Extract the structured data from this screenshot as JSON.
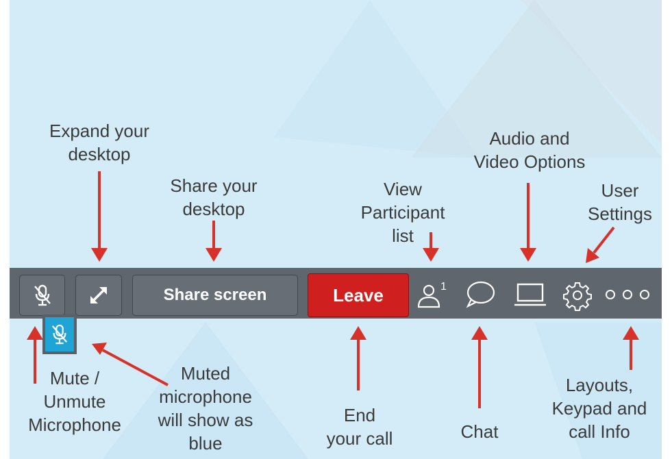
{
  "annotations": {
    "expand": "Expand your\ndesktop",
    "share": "Share your\ndesktop",
    "participants": "View\nParticipant\nlist",
    "av_options": "Audio and\nVideo Options",
    "user_settings": "User\nSettings",
    "mute": "Mute /\nUnmute\nMicrophone",
    "muted": "Muted\nmicrophone\nwill show as\nblue",
    "leave": "End\nyour call",
    "chat": "Chat",
    "layouts": "Layouts,\nKeypad and\ncall Info"
  },
  "toolbar": {
    "share_label": "Share screen",
    "leave_label": "Leave",
    "participant_count": "1"
  },
  "icons": {
    "mic": "microphone-icon",
    "expand": "expand-icon",
    "participants": "participants-icon",
    "chat": "chat-icon",
    "av": "laptop-icon",
    "settings": "gear-icon",
    "more": "more-icon",
    "muted_mic": "muted-microphone-icon"
  },
  "colors": {
    "background": "#d4ecf7",
    "toolbar": "#5f666d",
    "leave": "#d01f1f",
    "muted_blue": "#1fa4d6",
    "arrow": "#d6322a"
  }
}
